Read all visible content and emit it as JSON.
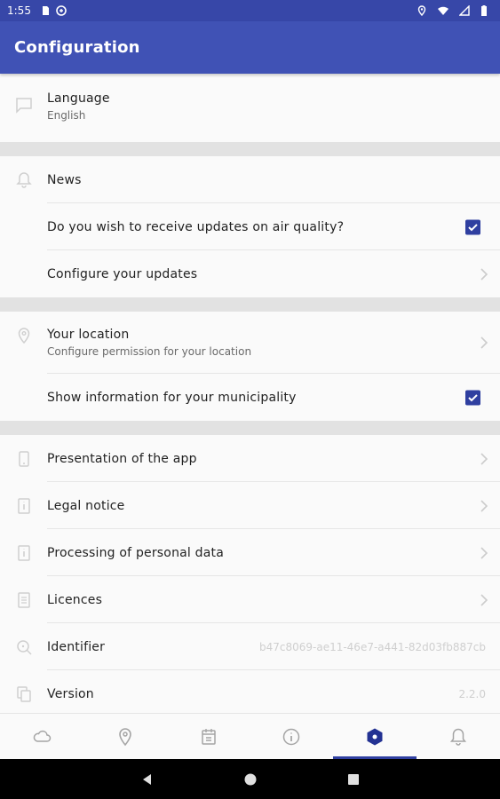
{
  "status_bar": {
    "time": "1:55"
  },
  "app_bar": {
    "title": "Configuration"
  },
  "language": {
    "label": "Language",
    "value": "English"
  },
  "news": {
    "label": "News",
    "air_quality_label": "Do you wish to receive updates on air quality?",
    "air_quality_checked": true,
    "configure_label": "Configure your updates"
  },
  "location": {
    "label": "Your location",
    "sub": "Configure permission for your location",
    "municipality_label": "Show information for your municipality",
    "municipality_checked": true
  },
  "about": {
    "presentation_label": "Presentation of the app",
    "legal_label": "Legal notice",
    "personal_data_label": "Processing of personal data",
    "licences_label": "Licences",
    "identifier_label": "Identifier",
    "identifier_value": "b47c8069-ae11-46e7-a441-82d03fb887cb",
    "version_label": "Version",
    "version_value": "2.2.0"
  },
  "bottom_nav": {
    "tabs": [
      {
        "icon": "cloud-icon",
        "active": false
      },
      {
        "icon": "location-pin-icon",
        "active": false
      },
      {
        "icon": "calendar-icon",
        "active": false
      },
      {
        "icon": "info-icon",
        "active": false
      },
      {
        "icon": "settings-hexagon-icon",
        "active": true
      },
      {
        "icon": "bell-icon",
        "active": false
      }
    ]
  },
  "colors": {
    "status_bar": "#3747a8",
    "app_bar": "#4052b5",
    "accent": "#2f3fa0",
    "active_tab": "#233293"
  }
}
